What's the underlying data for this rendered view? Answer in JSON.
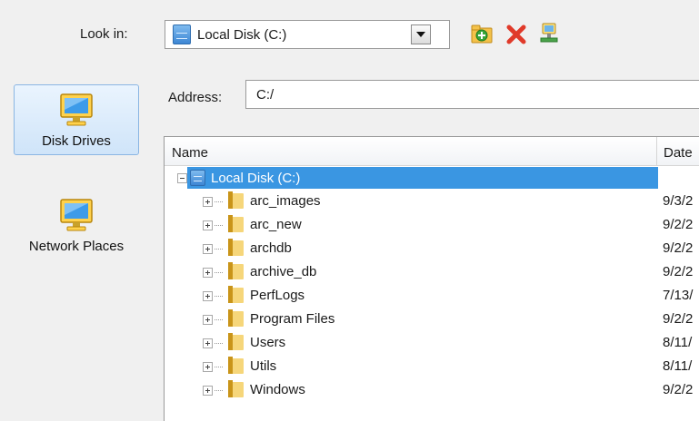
{
  "look_in": {
    "label": "Look in:",
    "value": "Local Disk (C:)"
  },
  "toolbar": {
    "icons": [
      "new-folder-icon",
      "delete-icon",
      "network-drive-icon"
    ]
  },
  "sidebar": {
    "items": [
      {
        "label": "Disk Drives",
        "icon": "monitor-icon",
        "selected": true
      },
      {
        "label": "Network Places",
        "icon": "network-monitor-icon",
        "selected": false
      }
    ]
  },
  "address": {
    "label": "Address:",
    "value": "C:/"
  },
  "tree": {
    "columns": {
      "name": "Name",
      "date": "Date"
    },
    "root": {
      "name": "Local Disk (C:)"
    },
    "rows": [
      {
        "name": "arc_images",
        "date": "9/3/2"
      },
      {
        "name": "arc_new",
        "date": "9/2/2"
      },
      {
        "name": "archdb",
        "date": "9/2/2"
      },
      {
        "name": "archive_db",
        "date": "9/2/2"
      },
      {
        "name": "PerfLogs",
        "date": "7/13/"
      },
      {
        "name": "Program Files",
        "date": "9/2/2"
      },
      {
        "name": "Users",
        "date": "8/11/"
      },
      {
        "name": "Utils",
        "date": "8/11/"
      },
      {
        "name": "Windows",
        "date": "9/2/2"
      }
    ]
  },
  "colors": {
    "selection": "#3a96e2",
    "selected_tab": "#cfe4f9",
    "background": "#f0f0f0"
  }
}
